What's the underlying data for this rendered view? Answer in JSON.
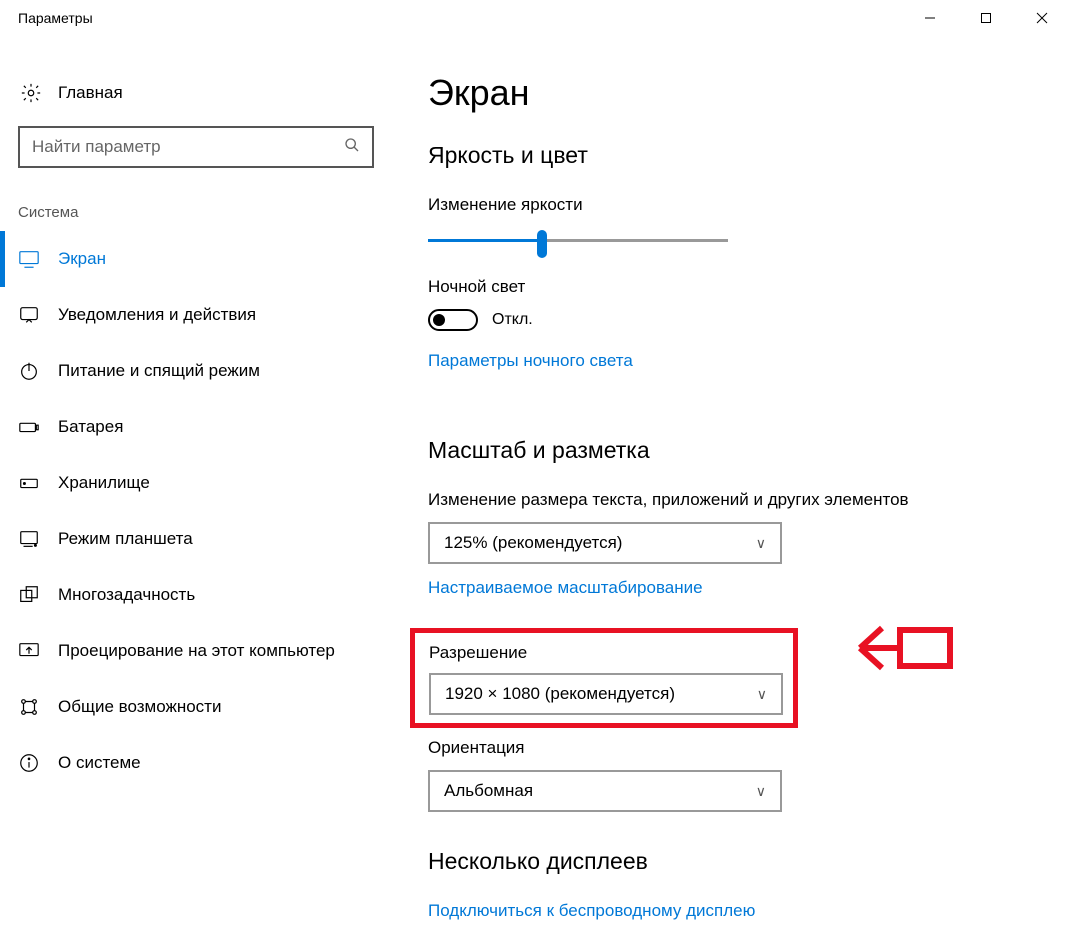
{
  "window": {
    "title": "Параметры"
  },
  "sidebar": {
    "home_label": "Главная",
    "search_placeholder": "Найти параметр",
    "group_label": "Система",
    "items": [
      {
        "label": "Экран",
        "icon": "display-icon",
        "selected": true
      },
      {
        "label": "Уведомления и действия",
        "icon": "notifications-icon"
      },
      {
        "label": "Питание и спящий режим",
        "icon": "power-icon"
      },
      {
        "label": "Батарея",
        "icon": "battery-icon"
      },
      {
        "label": "Хранилище",
        "icon": "storage-icon"
      },
      {
        "label": "Режим планшета",
        "icon": "tablet-icon"
      },
      {
        "label": "Многозадачность",
        "icon": "multitask-icon"
      },
      {
        "label": "Проецирование на этот компьютер",
        "icon": "project-icon"
      },
      {
        "label": "Общие возможности",
        "icon": "shared-icon"
      },
      {
        "label": "О системе",
        "icon": "about-icon"
      }
    ]
  },
  "main": {
    "title": "Экран",
    "brightness": {
      "heading": "Яркость и цвет",
      "slider_label": "Изменение яркости",
      "slider_percent": 38,
      "night_light_label": "Ночной свет",
      "night_light_state": "Откл.",
      "night_light_link": "Параметры ночного света"
    },
    "scale": {
      "heading": "Масштаб и разметка",
      "scale_label": "Изменение размера текста, приложений и других элементов",
      "scale_value": "125% (рекомендуется)",
      "custom_link": "Настраиваемое масштабирование",
      "resolution_label": "Разрешение",
      "resolution_value": "1920 × 1080 (рекомендуется)",
      "orientation_label": "Ориентация",
      "orientation_value": "Альбомная"
    },
    "multi": {
      "heading": "Несколько дисплеев",
      "connect_link": "Подключиться к беспроводному дисплею"
    }
  },
  "annotation": {
    "highlight_color": "#e81123"
  }
}
